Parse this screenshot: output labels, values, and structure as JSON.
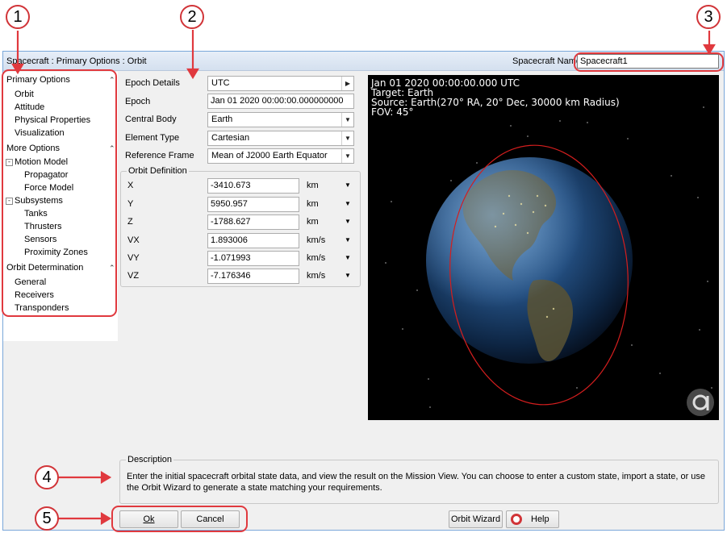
{
  "window": {
    "title": "Spacecraft : Primary Options : Orbit",
    "spacecraft_name_label": "Spacecraft Name",
    "spacecraft_name_value": "Spacecraft1"
  },
  "nav": {
    "primary_options": "Primary Options",
    "orbit": "Orbit",
    "attitude": "Attitude",
    "physical_properties": "Physical Properties",
    "visualization": "Visualization",
    "more_options": "More Options",
    "motion_model": "Motion Model",
    "propagator": "Propagator",
    "force_model": "Force Model",
    "subsystems": "Subsystems",
    "tanks": "Tanks",
    "thrusters": "Thrusters",
    "sensors": "Sensors",
    "proximity_zones": "Proximity Zones",
    "orbit_determination": "Orbit Determination",
    "general": "General",
    "receivers": "Receivers",
    "transponders": "Transponders"
  },
  "form": {
    "epoch_details_label": "Epoch Details",
    "epoch_details_value": "UTC",
    "epoch_label": "Epoch",
    "epoch_value": "Jan 01 2020 00:00:00.000000000",
    "central_body_label": "Central Body",
    "central_body_value": "Earth",
    "element_type_label": "Element Type",
    "element_type_value": "Cartesian",
    "reference_frame_label": "Reference Frame",
    "reference_frame_value": "Mean of J2000 Earth Equator"
  },
  "orbit_definition": {
    "legend": "Orbit Definition",
    "rows": [
      {
        "label": "X",
        "value": "-3410.673",
        "unit": "km"
      },
      {
        "label": "Y",
        "value": "5950.957",
        "unit": "km"
      },
      {
        "label": "Z",
        "value": "-1788.627",
        "unit": "km"
      },
      {
        "label": "VX",
        "value": "1.893006",
        "unit": "km/s"
      },
      {
        "label": "VY",
        "value": "-1.071993",
        "unit": "km/s"
      },
      {
        "label": "VZ",
        "value": "-7.176346",
        "unit": "km/s"
      }
    ]
  },
  "view": {
    "line1": "Jan 01 2020 00:00:00.000 UTC",
    "line2": "Target: Earth",
    "line3": "Source: Earth(270° RA, 20° Dec, 30000 km Radius)",
    "line4": "FOV: 45°"
  },
  "description": {
    "legend": "Description",
    "text": "Enter the initial spacecraft orbital state data, and view the result on the Mission View. You can choose to enter a custom state, import a state, or use the Orbit Wizard to generate a state matching your requirements."
  },
  "buttons": {
    "ok": "Ok",
    "cancel": "Cancel",
    "orbit_wizard": "Orbit Wizard",
    "help": "Help"
  },
  "callouts": [
    "1",
    "2",
    "3",
    "4",
    "5"
  ],
  "colors": {
    "callout_red": "#e0393e",
    "orbit_line": "#d41e1e",
    "view_background": "#000000"
  }
}
